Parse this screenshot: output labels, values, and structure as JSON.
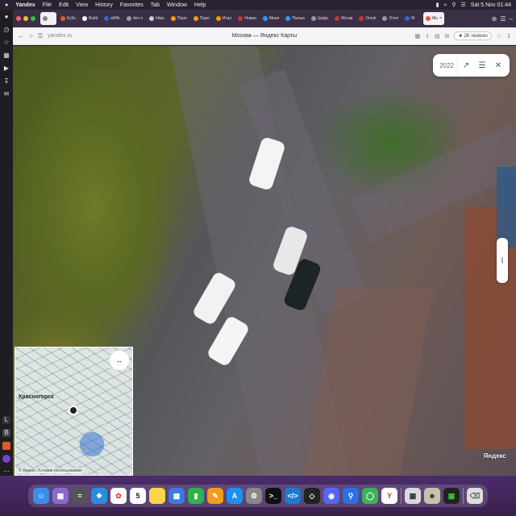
{
  "menubar": {
    "app": "Yandex",
    "items": [
      "File",
      "Edit",
      "View",
      "History",
      "Favorites",
      "Tab",
      "Window",
      "Help"
    ],
    "datetime": "Sat 5 Nov  01:44"
  },
  "tabs": [
    {
      "label": ""
    },
    {
      "label": "Кубо"
    },
    {
      "label": "Build"
    },
    {
      "label": "elliffe"
    },
    {
      "label": "dev-v"
    },
    {
      "label": "https"
    },
    {
      "label": "Пере"
    },
    {
      "label": "Пере"
    },
    {
      "label": "Итал"
    },
    {
      "label": "Новая"
    },
    {
      "label": "Мини"
    },
    {
      "label": "Пальм"
    },
    {
      "label": "Цифр"
    },
    {
      "label": "Москв"
    },
    {
      "label": "Omsk"
    },
    {
      "label": "Отел"
    },
    {
      "label": "М"
    },
    {
      "label": "Mu"
    }
  ],
  "address": {
    "url": "yandex.ru",
    "page_title": "Москва — Яндекс Карты",
    "reviews": "2K reviews"
  },
  "map": {
    "year": "2022",
    "watermark": "Яндекс"
  },
  "minimap": {
    "city_label": "Красногорск",
    "legal": "© Яндекс  Условия использования"
  },
  "dock": {
    "calendar_day": "5"
  },
  "colors": {
    "menubar": "#2a2233",
    "tabbar": "#3a2f46",
    "dock": "#4b2d6a"
  }
}
